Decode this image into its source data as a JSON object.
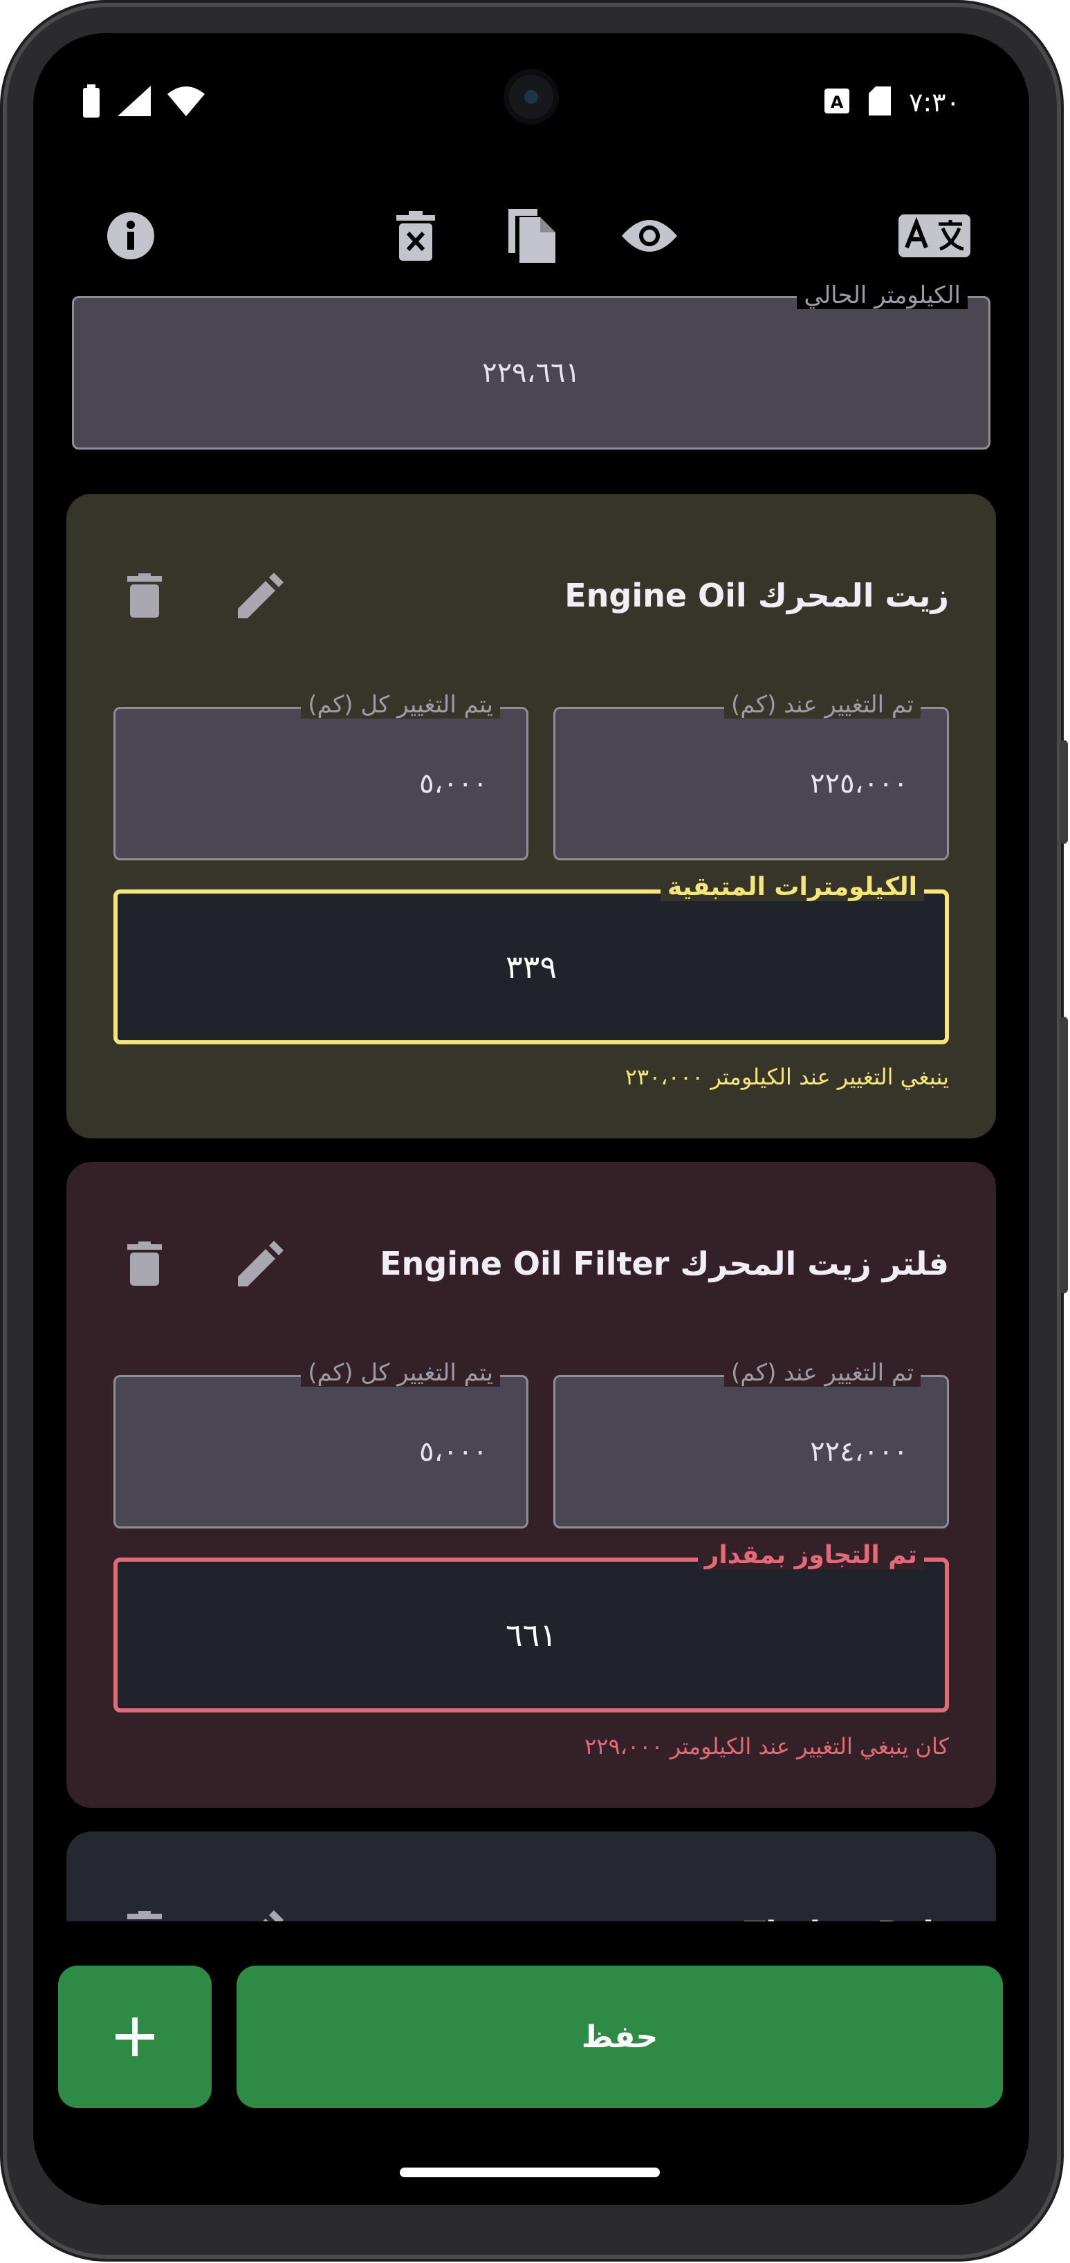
{
  "status_bar": {
    "time": "٧:٣٠",
    "left_icons": [
      "battery-icon",
      "signal-icon",
      "wifi-icon"
    ],
    "right_icons": [
      "accessibility-a-icon",
      "sd-card-icon"
    ]
  },
  "toolbar": {
    "icons": [
      "info-icon",
      "delete-x-icon",
      "copy-icon",
      "eye-icon",
      "translate-icon"
    ]
  },
  "odometer": {
    "label": "الكيلومتر الحالي",
    "value": "٢٢٩،٦٦١"
  },
  "items": [
    {
      "title": "Engine Oil  زيت المحرك",
      "changed_at_label": "تم التغيير عند (كم)",
      "changed_at_value": "٢٢٥،٠٠٠",
      "interval_label": "يتم التغيير كل (كم)",
      "interval_value": "٥،٠٠٠",
      "status_label": "الكيلومترات المتبقية",
      "status_value": "٣٣٩",
      "note": "ينبغي التغيير عند الكيلومتر ٢٣٠،٠٠٠",
      "colors": {
        "card": "#37352a",
        "accent": "#f4e67a"
      }
    },
    {
      "title": "Engine Oil Filter  فلتر زيت المحرك",
      "changed_at_label": "تم التغيير عند (كم)",
      "changed_at_value": "٢٢٤،٠٠٠",
      "interval_label": "يتم التغيير كل (كم)",
      "interval_value": "٥،٠٠٠",
      "status_label": "تم التجاوز بمقدار",
      "status_value": "٦٦١",
      "note": "كان ينبغي التغيير عند الكيلومتر ٢٢٩،٠٠٠",
      "colors": {
        "card": "#342128",
        "accent": "#e46a79"
      }
    }
  ],
  "partial_item": {
    "title": "Timing Belt",
    "colors": {
      "card": "#252830"
    }
  },
  "actions": {
    "add_label": "+",
    "save_label": "حفظ"
  }
}
